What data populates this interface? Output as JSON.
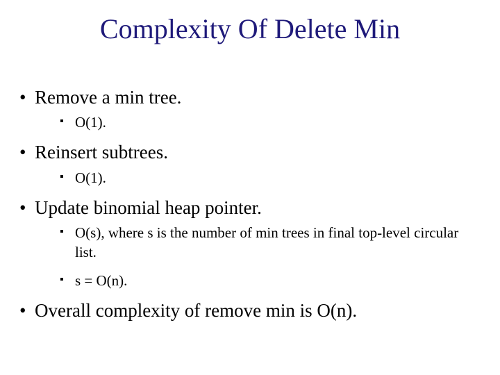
{
  "title": "Complexity Of Delete Min",
  "items": [
    {
      "text": "Remove a min tree.",
      "level": 1
    },
    {
      "text": "O(1).",
      "level": 2
    },
    {
      "text": "Reinsert subtrees.",
      "level": 1
    },
    {
      "text": "O(1).",
      "level": 2
    },
    {
      "text": "Update binomial heap pointer.",
      "level": 1
    },
    {
      "text": "O(s), where s is the number of min trees in final top-level circular list.",
      "level": 2
    },
    {
      "text": "s = O(n).",
      "level": 2
    },
    {
      "text": "Overall complexity of remove min is O(n).",
      "level": 1
    }
  ]
}
